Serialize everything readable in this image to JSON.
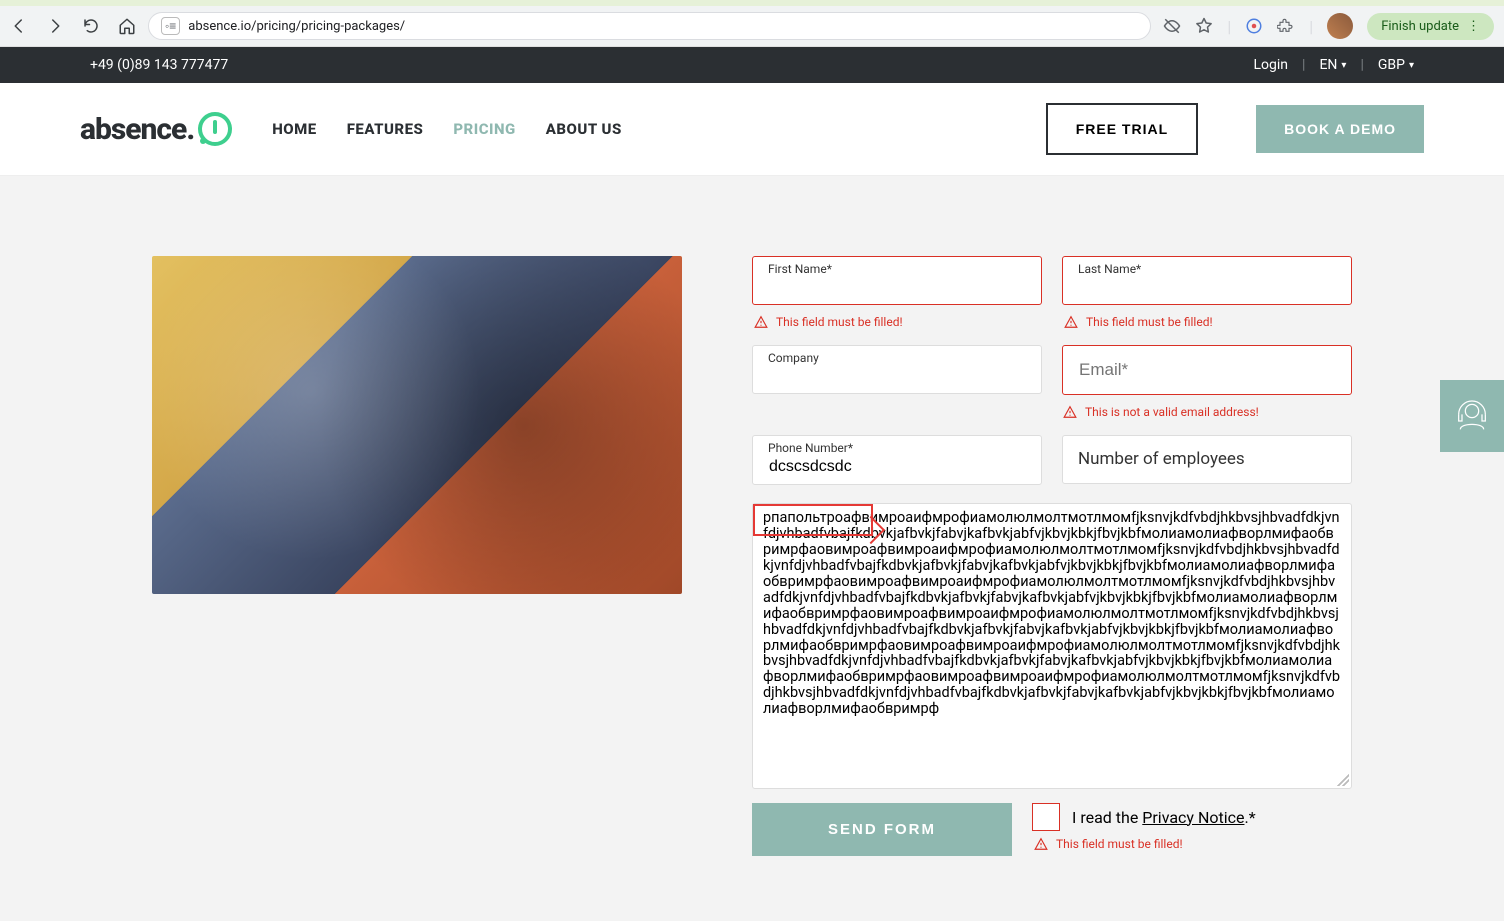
{
  "browser": {
    "url": "absence.io/pricing/pricing-packages/",
    "update_label": "Finish update"
  },
  "topbar": {
    "phone": "+49 (0)89 143 777477",
    "login": "Login",
    "lang": "EN",
    "currency": "GBP"
  },
  "nav": {
    "home": "HOME",
    "features": "FEATURES",
    "pricing": "PRICING",
    "about": "ABOUT US",
    "free_trial": "FREE TRIAL",
    "book_demo": "BOOK A DEMO"
  },
  "form": {
    "first_name_label": "First Name*",
    "last_name_label": "Last Name*",
    "company_label": "Company",
    "email_placeholder": "Email*",
    "phone_label": "Phone Number*",
    "phone_value": "dcscsdcsdc",
    "employees_placeholder": "Number of employees",
    "message_label": "",
    "message_value": "рпапольтроафвимроаифмрофиамолюлмолтмотлмомfjksnvjkdfvbdjhkbvsjhbvadfdkjvnfdjvhbadfvbajfkdbvkjafbvkjfabvjkafbvkjabfvjkbvjkbkjfbvjkbfмолиамолиафворлмифаобвримрфаовимроафвимроаифмрофиамолюлмолтмотлмомfjksnvjkdfvbdjhkbvsjhbvadfdkjvnfdjvhbadfvbajfkdbvkjafbvkjfabvjkafbvkjabfvjkbvjkbkjfbvjkbfмолиамолиафворлмифаобвримрфаовимроафвимроаифмрофиамолюлмолтмотлмомfjksnvjkdfvbdjhkbvsjhbvadfdkjvnfdjvhbadfvbajfkdbvkjafbvkjfabvjkafbvkjabfvjkbvjkbkjfbvjkbfмолиамолиафворлмифаобвримрфаовимроафвимроаифмрофиамолюлмолтмотлмомfjksnvjkdfvbdjhkbvsjhbvadfdkjvnfdjvhbadfvbajfkdbvkjafbvkjfabvjkafbvkjabfvjkbvjkbkjfbvjkbfмолиамолиафворлмифаобвримрфаовимроафвимроаифмрофиамолюлмолтмотлмомfjksnvjkdfvbdjhkbvsjhbvadfdkjvnfdjvhbadfvbajfkdbvkjafbvkjfabvjkafbvkjabfvjkbvjkbkjfbvjkbfмолиамолиафворлмифаобвримрфаовимроафвимроаифмрофиамолюлмолтмотлмомfjksnvjkdfvbdjhkbvsjhbvadfdkjvnfdjvhbadfvbajfkdbvkjafbvkjfabvjkafbvkjabfvjkbvjkbkjfbvjkbfмолиамолиафворлмифаобвримрф",
    "send_label": "SEND FORM",
    "privacy_prefix": "I read the ",
    "privacy_link": "Privacy Notice",
    "privacy_suffix": ".*"
  },
  "errors": {
    "field_required": "This field must be filled!",
    "invalid_email": "This is not a valid email address!"
  }
}
